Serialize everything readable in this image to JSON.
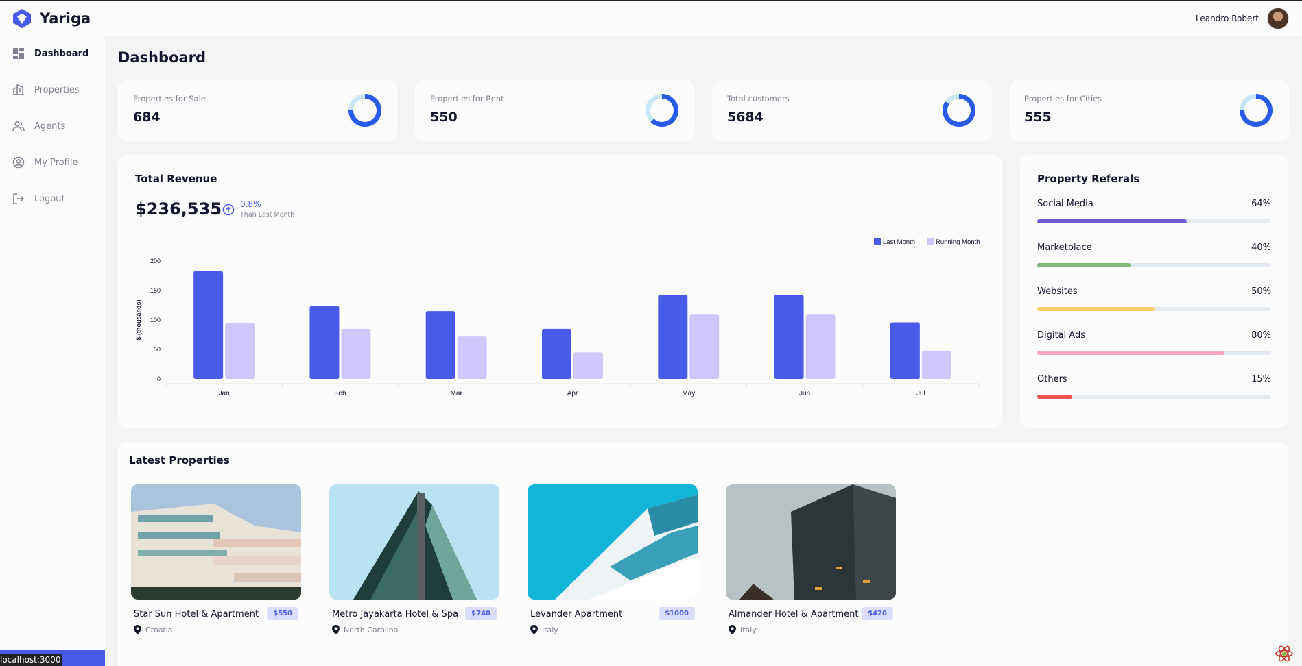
{
  "brand": {
    "name": "Yariga"
  },
  "user": {
    "name": "Leandro Robert"
  },
  "sidebar": {
    "items": [
      {
        "label": "Dashboard",
        "icon": "dashboard-icon",
        "active": true
      },
      {
        "label": "Properties",
        "icon": "building-icon"
      },
      {
        "label": "Agents",
        "icon": "people-icon"
      },
      {
        "label": "My Profile",
        "icon": "profile-icon"
      },
      {
        "label": "Logout",
        "icon": "logout-icon"
      }
    ]
  },
  "status_bar": {
    "url": "localhost:3000"
  },
  "page": {
    "title": "Dashboard"
  },
  "stats": [
    {
      "label": "Properties for Sale",
      "value": "684"
    },
    {
      "label": "Properties for Rent",
      "value": "550"
    },
    {
      "label": "Total customers",
      "value": "5684"
    },
    {
      "label": "Properties for Cities",
      "value": "555"
    }
  ],
  "revenue": {
    "title": "Total Revenue",
    "total": "$236,535",
    "change_pct": "0.8%",
    "change_caption": "Than Last Month"
  },
  "chart_data": {
    "type": "bar",
    "title": "",
    "xlabel": "",
    "ylabel": "$ (thousands)",
    "categories": [
      "Jan",
      "Feb",
      "Mar",
      "Apr",
      "May",
      "Jun",
      "Jul"
    ],
    "series": [
      {
        "name": "Last Month",
        "color": "#475be8",
        "values": [
          183,
          124,
          115,
          85,
          143,
          143,
          96
        ]
      },
      {
        "name": "Running Month",
        "color": "#cfc8ff",
        "values": [
          95,
          85,
          72,
          45,
          109,
          109,
          48
        ]
      }
    ],
    "ylim": [
      0,
      200
    ],
    "yticks": [
      0,
      50,
      100,
      150,
      200
    ],
    "legend": "top-right",
    "grid": false
  },
  "referrals": {
    "title": "Property Referals",
    "items": [
      {
        "label": "Social Media",
        "percent": 64,
        "color": "#6c5dd3"
      },
      {
        "label": "Marketplace",
        "percent": 40,
        "color": "#7fba7a"
      },
      {
        "label": "Websites",
        "percent": 50,
        "color": "#ffce73"
      },
      {
        "label": "Digital Ads",
        "percent": 80,
        "color": "#ffa2c0"
      },
      {
        "label": "Others",
        "percent": 15,
        "color": "#f45252"
      }
    ]
  },
  "latest": {
    "title": "Latest Properties",
    "items": [
      {
        "name": "Star Sun Hotel & Apartment",
        "price": "$550",
        "location": "Croatia"
      },
      {
        "name": "Metro Jayakarta Hotel & Spa",
        "price": "$740",
        "location": "North Carolina"
      },
      {
        "name": "Levander Apartment",
        "price": "$1000",
        "location": "Italy"
      },
      {
        "name": "Almander Hotel & Apartment",
        "price": "$420",
        "location": "Italy"
      }
    ]
  }
}
